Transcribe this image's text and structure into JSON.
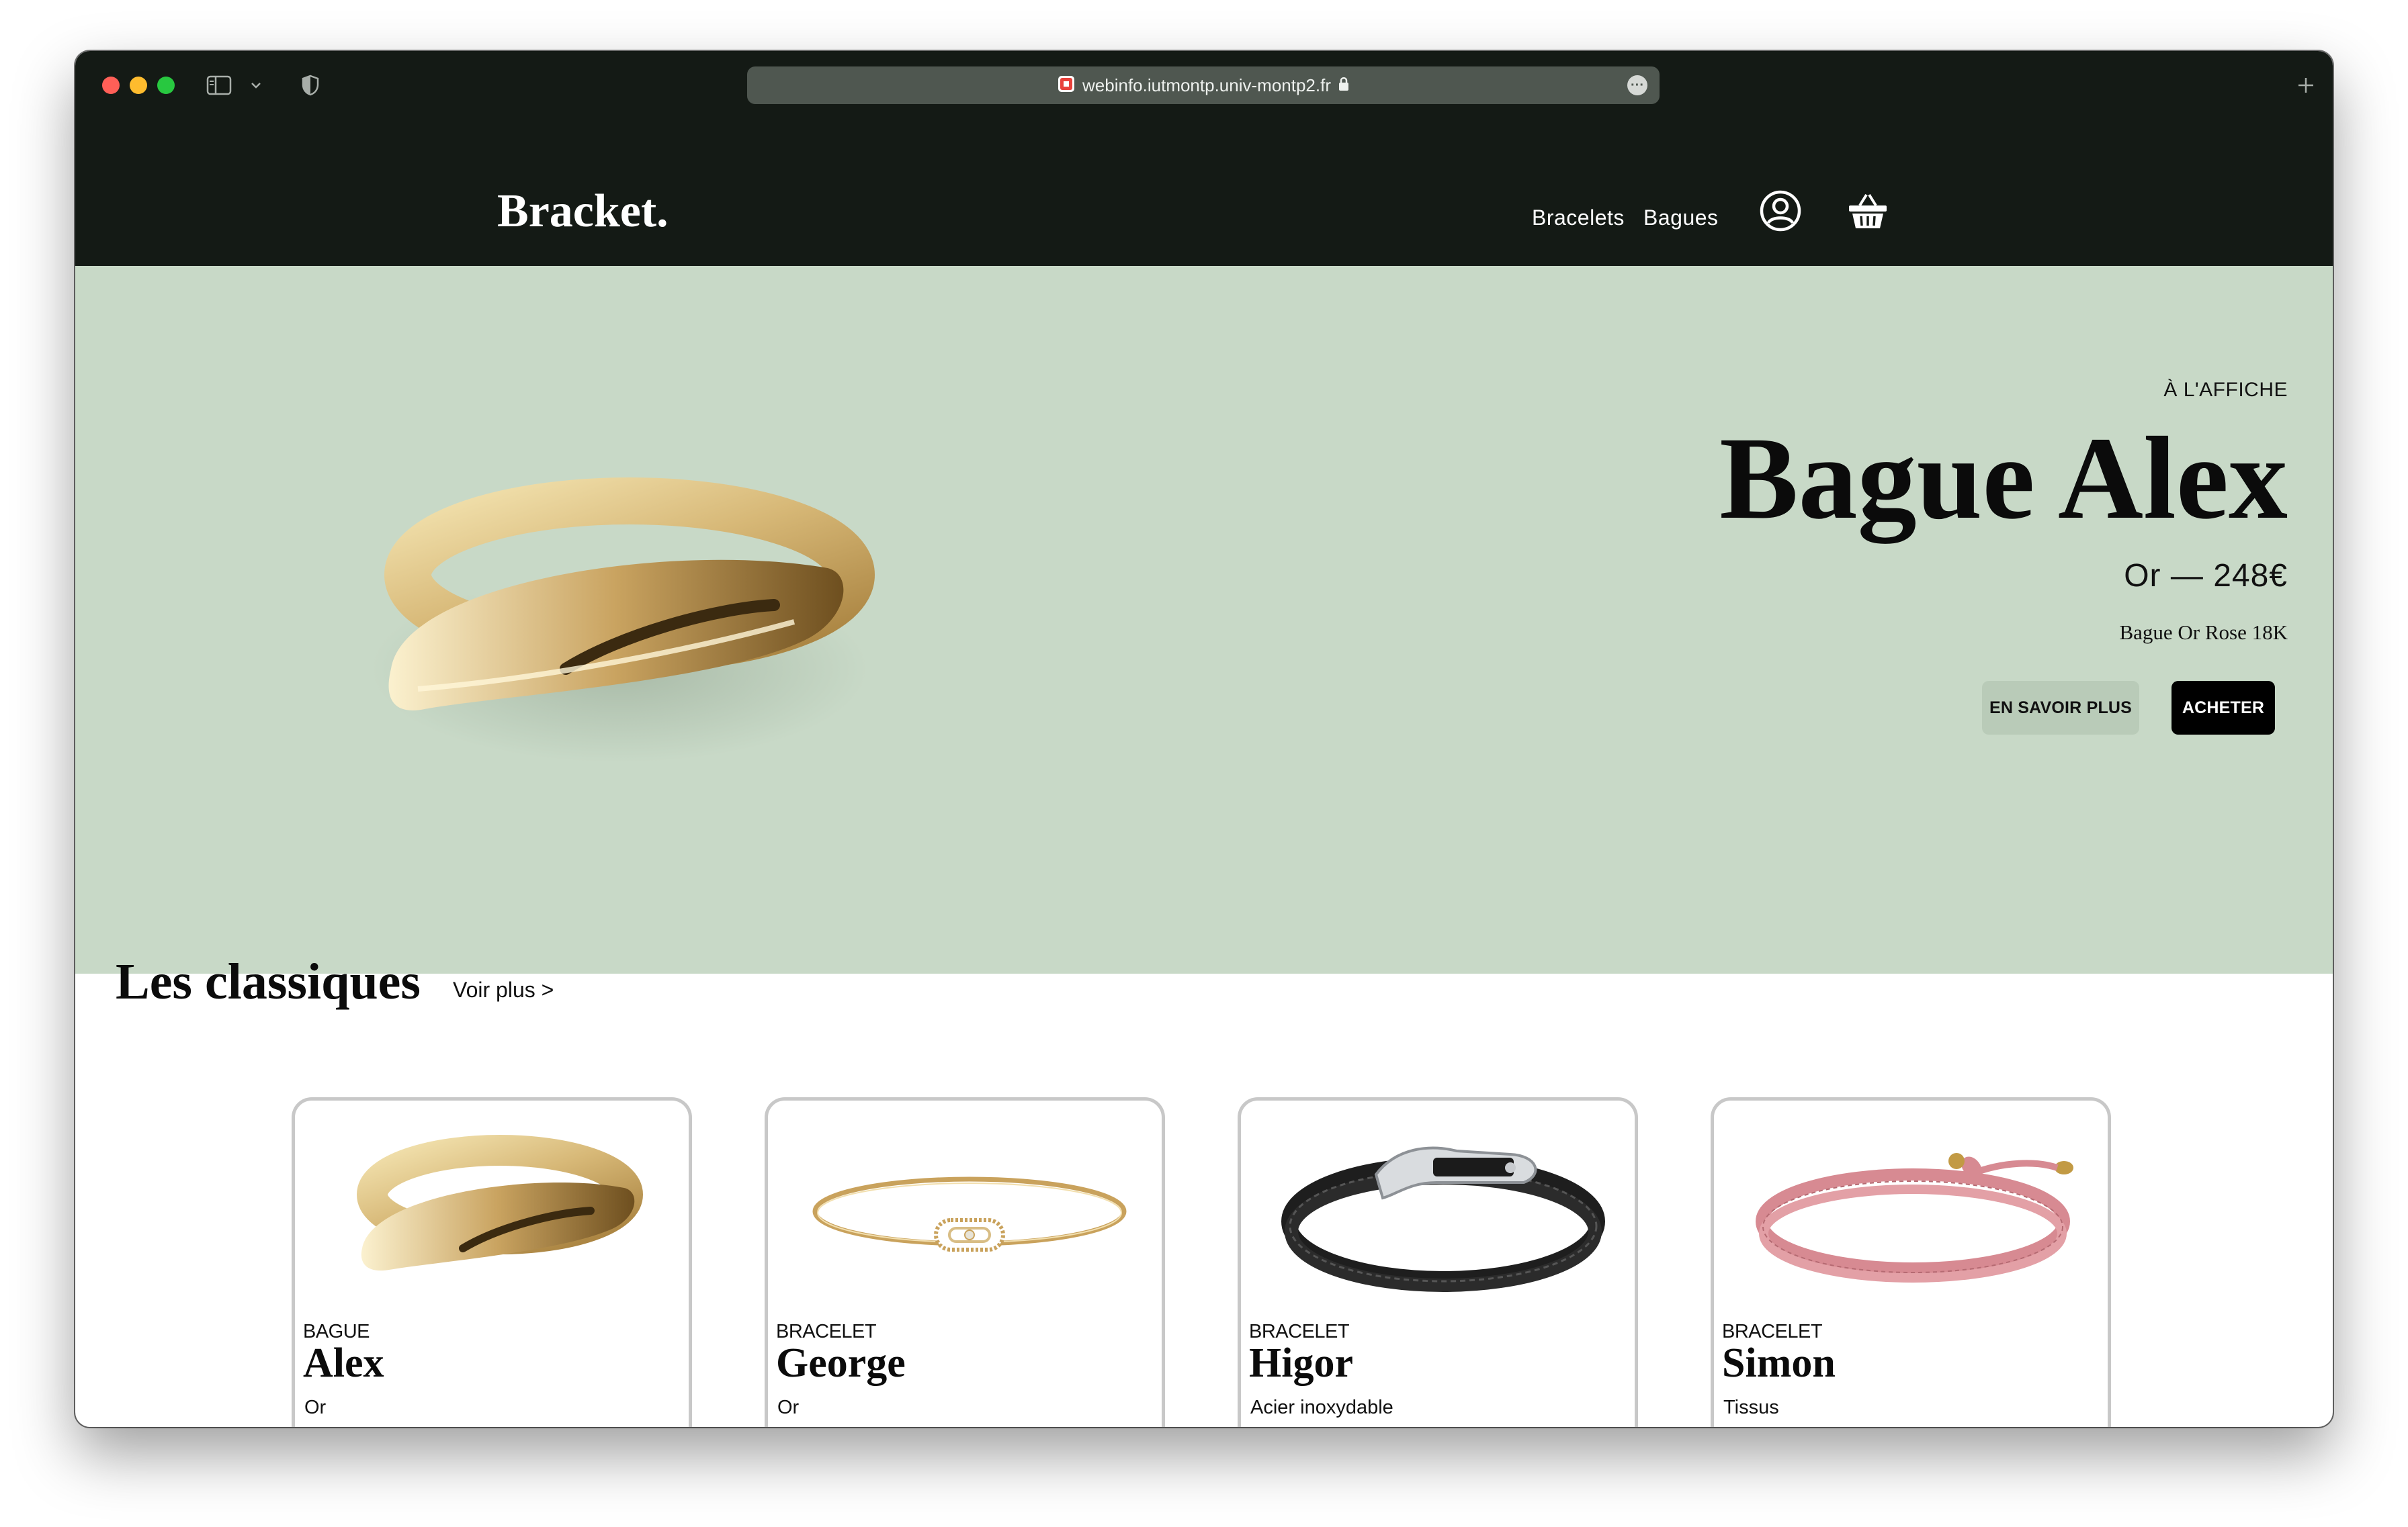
{
  "browser": {
    "url": "webinfo.iutmontp.univ-montp2.fr",
    "more_label": "···"
  },
  "header": {
    "logo": "Bracket.",
    "nav": [
      "Bracelets",
      "Bagues"
    ],
    "account_icon": "user-circle-icon",
    "cart_icon": "basket-icon",
    "bg_color": "#141a15"
  },
  "hero": {
    "label": "À L'AFFICHE",
    "title": "Bague Alex",
    "subtitle": "Or — 248€",
    "description": "Bague Or Rose 18K",
    "secondary_button": "EN SAVOIR PLUS",
    "primary_button": "ACHETER",
    "bg_color": "#c8d9c7"
  },
  "classics": {
    "title": "Les classiques",
    "see_more": "Voir plus >",
    "products": [
      {
        "type": "BAGUE",
        "name": "Alex",
        "material": "Or"
      },
      {
        "type": "BRACELET",
        "name": "George",
        "material": "Or"
      },
      {
        "type": "BRACELET",
        "name": "Higor",
        "material": "Acier inoxydable"
      },
      {
        "type": "BRACELET",
        "name": "Simon",
        "material": "Tissus"
      }
    ]
  }
}
